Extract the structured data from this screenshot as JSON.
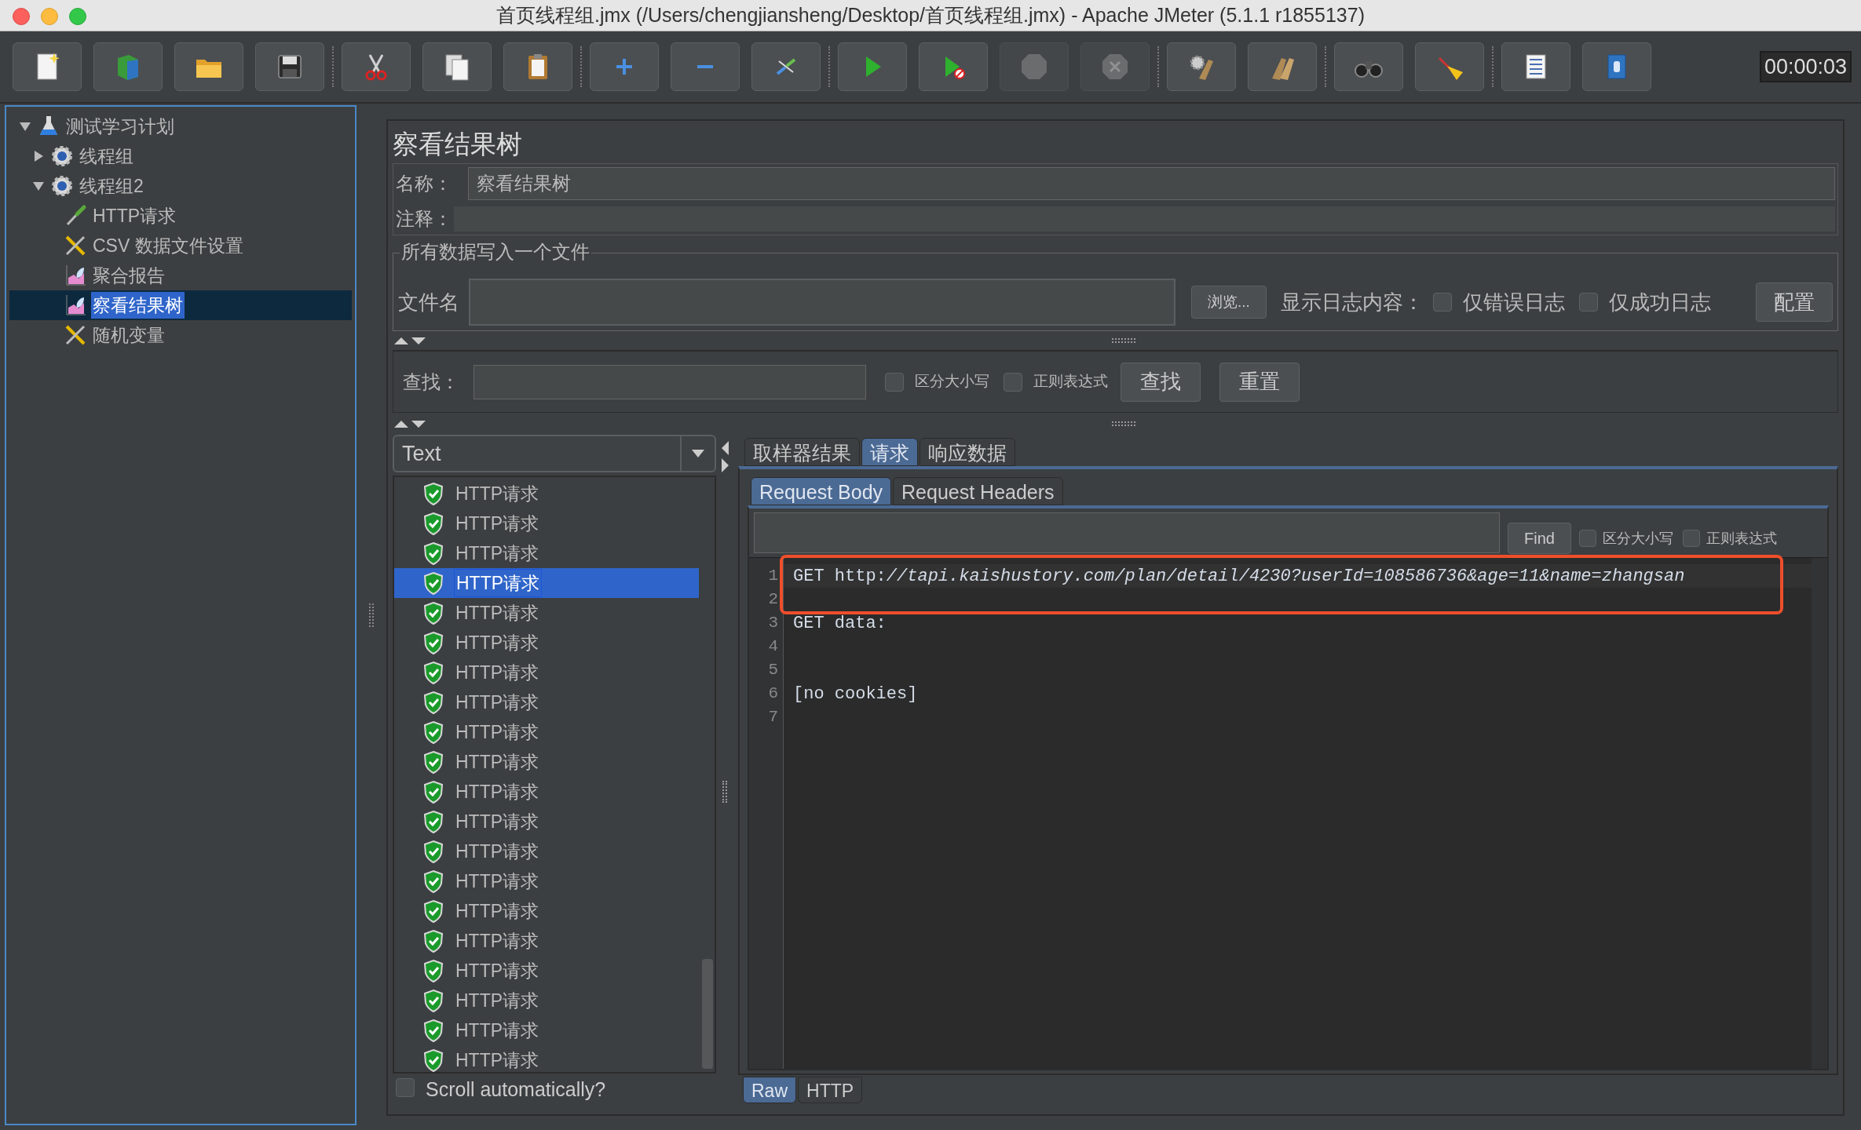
{
  "window": {
    "title": "首页线程组.jmx (/Users/chengjiansheng/Desktop/首页线程组.jmx) - Apache JMeter (5.1.1 r1855137)"
  },
  "toolbar": {
    "groups": [
      [
        {
          "kind": "new",
          "disabled": false
        },
        {
          "kind": "templates",
          "disabled": false
        },
        {
          "kind": "open",
          "disabled": false
        },
        {
          "kind": "save",
          "disabled": false
        }
      ],
      [
        {
          "kind": "cut",
          "disabled": false
        },
        {
          "kind": "copy",
          "disabled": false
        },
        {
          "kind": "paste",
          "disabled": false
        }
      ],
      [
        {
          "kind": "expand",
          "disabled": false
        },
        {
          "kind": "collapse",
          "disabled": false
        },
        {
          "kind": "toggle",
          "disabled": false
        }
      ],
      [
        {
          "kind": "start",
          "disabled": false
        },
        {
          "kind": "start_no_pause",
          "disabled": false
        },
        {
          "kind": "stop",
          "disabled": true
        },
        {
          "kind": "shutdown",
          "disabled": true
        }
      ],
      [
        {
          "kind": "clear",
          "disabled": false
        },
        {
          "kind": "clear_all",
          "disabled": false
        }
      ],
      [
        {
          "kind": "search",
          "disabled": false
        },
        {
          "kind": "reset_search",
          "disabled": false
        }
      ],
      [
        {
          "kind": "functions",
          "disabled": false
        },
        {
          "kind": "help",
          "disabled": false
        }
      ]
    ],
    "timer": "00:00:03"
  },
  "tree": [
    {
      "label": "测试学习计划",
      "kind": "plan",
      "expanded": true,
      "selected": false,
      "children": [
        {
          "label": "线程组",
          "kind": "thread_group",
          "expanded": false,
          "selected": false
        },
        {
          "label": "线程组2",
          "kind": "thread_group",
          "expanded": true,
          "selected": false,
          "children": [
            {
              "label": "HTTP请求",
              "kind": "sampler",
              "selected": false
            },
            {
              "label": "CSV 数据文件设置",
              "kind": "config",
              "selected": false
            },
            {
              "label": "聚合报告",
              "kind": "listener",
              "selected": false
            },
            {
              "label": "察看结果树",
              "kind": "listener",
              "selected": true
            },
            {
              "label": "随机变量",
              "kind": "config",
              "selected": false
            }
          ]
        }
      ]
    }
  ],
  "panel": {
    "title": "察看结果树",
    "name_label": "名称：",
    "name_value": "察看结果树",
    "comment_label": "注释："
  },
  "file_section": {
    "legend": "所有数据写入一个文件",
    "filename_label": "文件名",
    "browse_button": "浏览...",
    "log_label": "显示日志内容：",
    "checkboxes": [
      {
        "label": "仅错误日志",
        "checked": false
      },
      {
        "label": "仅成功日志",
        "checked": false
      }
    ],
    "configure_button": "配置"
  },
  "search": {
    "label": "查找：",
    "checkboxes": [
      {
        "label": "区分大小写",
        "checked": false
      },
      {
        "label": "正则表达式",
        "checked": false
      }
    ],
    "buttons": [
      "查找",
      "重置"
    ]
  },
  "results": {
    "renderer": "Text",
    "items": [
      {
        "label": "HTTP请求",
        "selected": false
      },
      {
        "label": "HTTP请求",
        "selected": false
      },
      {
        "label": "HTTP请求",
        "selected": false
      },
      {
        "label": "HTTP请求",
        "selected": true
      },
      {
        "label": "HTTP请求",
        "selected": false
      },
      {
        "label": "HTTP请求",
        "selected": false
      },
      {
        "label": "HTTP请求",
        "selected": false
      },
      {
        "label": "HTTP请求",
        "selected": false
      },
      {
        "label": "HTTP请求",
        "selected": false
      },
      {
        "label": "HTTP请求",
        "selected": false
      },
      {
        "label": "HTTP请求",
        "selected": false
      },
      {
        "label": "HTTP请求",
        "selected": false
      },
      {
        "label": "HTTP请求",
        "selected": false
      },
      {
        "label": "HTTP请求",
        "selected": false
      },
      {
        "label": "HTTP请求",
        "selected": false
      },
      {
        "label": "HTTP请求",
        "selected": false
      },
      {
        "label": "HTTP请求",
        "selected": false
      },
      {
        "label": "HTTP请求",
        "selected": false
      },
      {
        "label": "HTTP请求",
        "selected": false
      },
      {
        "label": "HTTP请求",
        "selected": false
      }
    ],
    "scroll_auto": {
      "label": "Scroll automatically?",
      "checked": false
    }
  },
  "detail_tabs": [
    {
      "label": "取样器结果",
      "selected": false
    },
    {
      "label": "请求",
      "selected": true
    },
    {
      "label": "响应数据",
      "selected": false
    }
  ],
  "request_tabs": [
    {
      "label": "Request Body",
      "selected": true
    },
    {
      "label": "Request Headers",
      "selected": false
    }
  ],
  "find_bar": {
    "button": "Find",
    "checkboxes": [
      {
        "label": "区分大小写",
        "checked": false
      },
      {
        "label": "正则表达式",
        "checked": false
      }
    ]
  },
  "code_lines": [
    {
      "number": "1",
      "text": "GET http:*//tapi.kaishustory.com/plan/detail/4230?userId=108586736&age=11&name=zhangsan*"
    },
    {
      "number": "2"
    },
    {
      "number": "3",
      "text": "GET data:"
    },
    {
      "number": "4"
    },
    {
      "number": "5"
    },
    {
      "number": "6",
      "text": "[no cookies]"
    },
    {
      "number": "7"
    }
  ],
  "view_tabs": [
    {
      "label": "Raw",
      "selected": true
    },
    {
      "label": "HTTP",
      "selected": false
    }
  ]
}
